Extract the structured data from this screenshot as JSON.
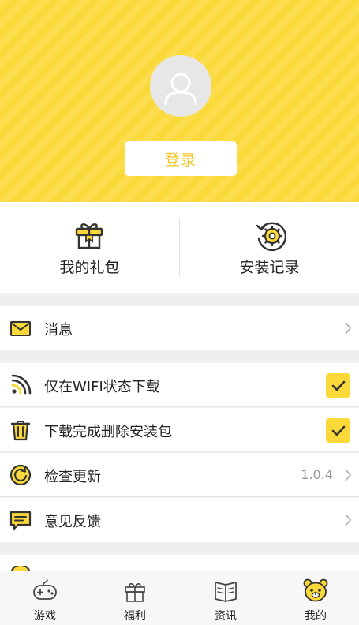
{
  "profile": {
    "login_label": "登录",
    "avatar_icon": "default-user-avatar"
  },
  "quick_actions": [
    {
      "label": "我的礼包",
      "icon": "gift-box-icon"
    },
    {
      "label": "安装记录",
      "icon": "gear-history-icon"
    }
  ],
  "settings": {
    "messages": {
      "label": "消息",
      "icon": "envelope-icon"
    },
    "wifi_only": {
      "label": "仅在WIFI状态下载",
      "icon": "rss-signal-icon",
      "checked": true
    },
    "delete_after_install": {
      "label": "下载完成删除安装包",
      "icon": "trash-icon",
      "checked": true
    },
    "check_update": {
      "label": "检查更新",
      "icon": "refresh-icon",
      "version": "1.0.4"
    },
    "feedback": {
      "label": "意见反馈",
      "icon": "chat-bubble-icon"
    }
  },
  "tabs": [
    {
      "label": "游戏",
      "icon": "gamepad-icon"
    },
    {
      "label": "福利",
      "icon": "gift-icon"
    },
    {
      "label": "资讯",
      "icon": "book-icon"
    },
    {
      "label": "我的",
      "icon": "bear-face-icon",
      "active": true
    }
  ],
  "colors": {
    "accent": "#fbd93a",
    "login_text": "#f3c623",
    "icon_dark": "#333333",
    "background": "#efefef"
  }
}
